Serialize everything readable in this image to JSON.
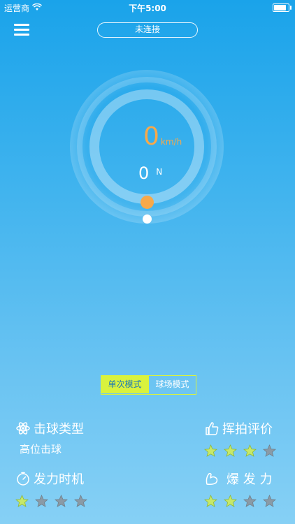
{
  "status_bar": {
    "carrier": "运营商",
    "time": "下午5:00",
    "battery_level": 0.95
  },
  "header": {
    "menu_icon": "hamburger-menu-icon",
    "connection_status": "未连接"
  },
  "gauge": {
    "speed_value": "0",
    "speed_unit": "km/h",
    "force_value": "0",
    "force_unit": "N"
  },
  "mode_toggle": {
    "single_label": "单次模式",
    "court_label": "球场模式",
    "selected": "single"
  },
  "stats": {
    "hit_type": {
      "icon": "atom-icon",
      "title": "击球类型",
      "value": "高位击球"
    },
    "swing_rating": {
      "icon": "thumbs-up-icon",
      "title": "挥拍评价",
      "stars_total": 4,
      "stars_filled": 3
    },
    "timing": {
      "icon": "stopwatch-icon",
      "title": "发力时机",
      "stars_total": 4,
      "stars_filled": 1
    },
    "power": {
      "icon": "flexed-arm-icon",
      "title": "爆 发 力",
      "stars_total": 4,
      "stars_filled": 2
    }
  },
  "colors": {
    "accent_orange": "#f7a94a",
    "mode_yellow": "#d9f23d",
    "star_green": "#c6e86a",
    "star_gray": "#8a9aa6"
  }
}
